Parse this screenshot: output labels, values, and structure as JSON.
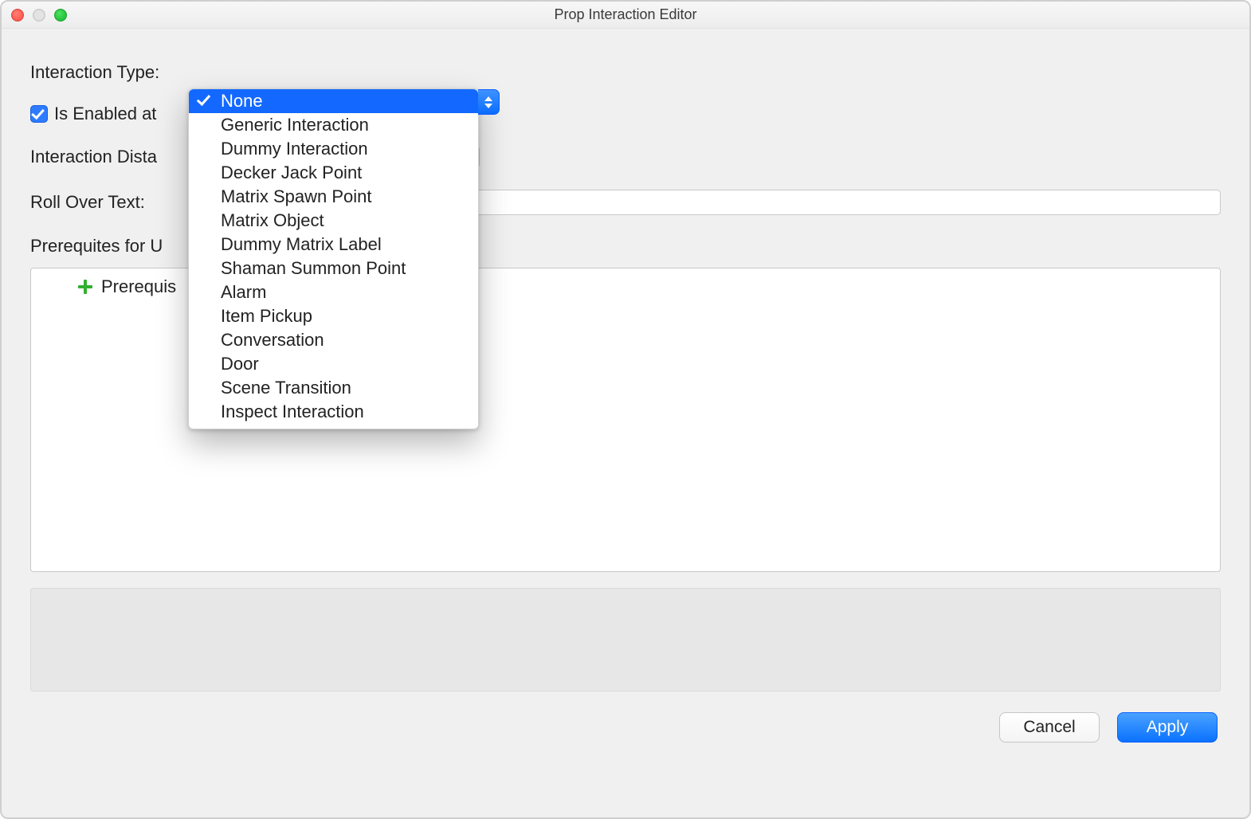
{
  "window": {
    "title": "Prop Interaction Editor"
  },
  "labels": {
    "interaction_type": "Interaction Type:",
    "enabled_at": "Is Enabled at",
    "interaction_dist": "Interaction Dista",
    "roll_over": "Roll Over Text:",
    "prereq_for": "Prerequites for U"
  },
  "prereq": {
    "item_label": "Prerequis"
  },
  "dropdown": {
    "selected_index": 0,
    "items": [
      "None",
      "Generic Interaction",
      "Dummy Interaction",
      "Decker Jack Point",
      "Matrix Spawn Point",
      "Matrix Object",
      "Dummy Matrix Label",
      "Shaman Summon Point",
      "Alarm",
      "Item Pickup",
      "Conversation",
      "Door",
      "Scene Transition",
      "Inspect Interaction"
    ]
  },
  "buttons": {
    "cancel": "Cancel",
    "apply": "Apply"
  }
}
